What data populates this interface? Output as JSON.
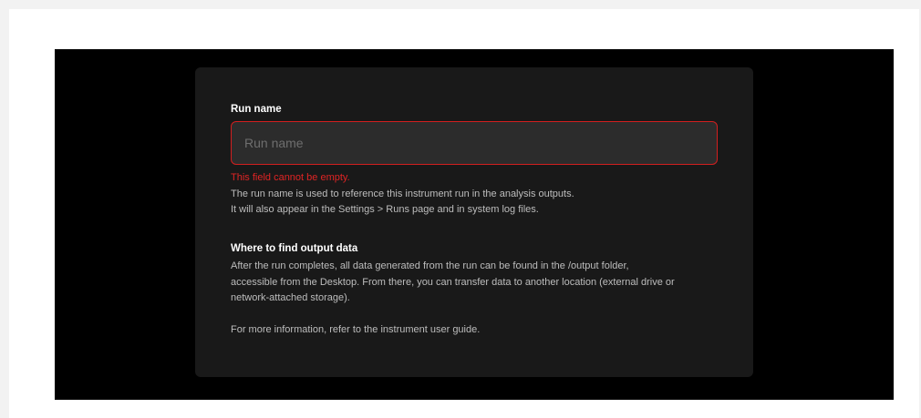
{
  "form": {
    "run_name_label": "Run name",
    "run_name_value": "",
    "run_name_placeholder": "Run name",
    "error_message": "This field cannot be empty.",
    "help_lines": [
      "The run name is used to reference this instrument run in the analysis outputs.",
      "It will also appear in the Settings > Runs page and in system log files."
    ]
  },
  "output_section": {
    "title": "Where to find output data",
    "body_lines": [
      "After the run completes, all data generated from the run can be found in the /output folder,",
      "accessible from the Desktop. From there, you can transfer data to another location (external drive or",
      "network-attached storage)."
    ],
    "more_info": "For more information, refer to the instrument user guide."
  },
  "colors": {
    "error": "#e02424",
    "card_background": "#191919",
    "stage_background": "#000000"
  }
}
